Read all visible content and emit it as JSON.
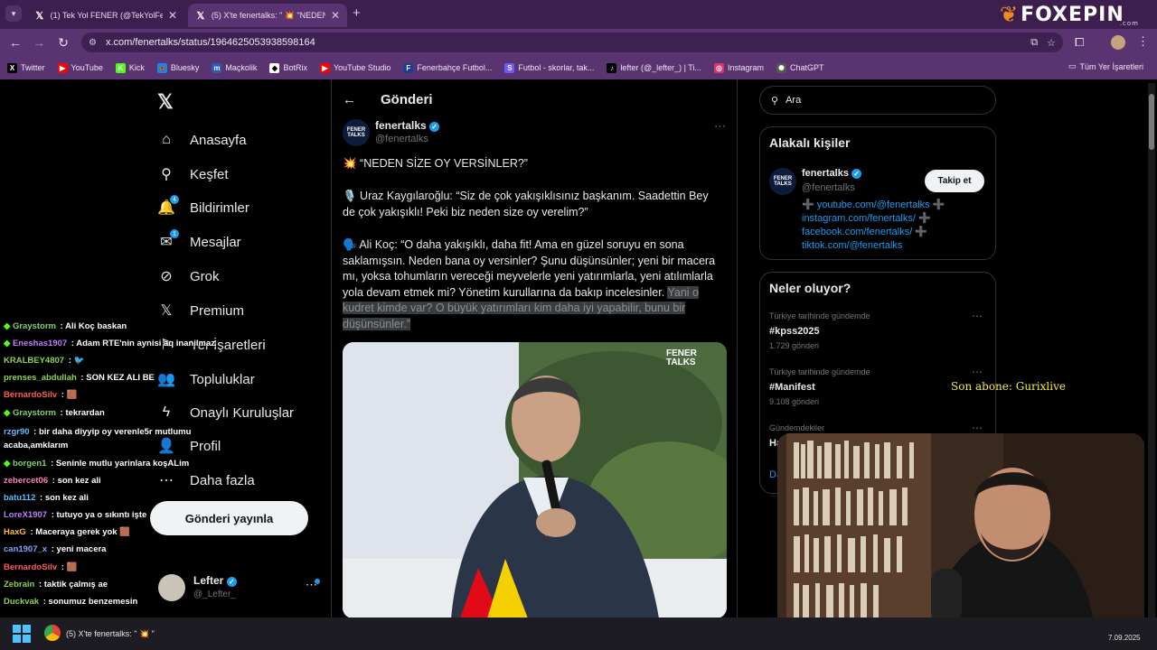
{
  "browser": {
    "tabs": [
      {
        "title": "(1) Tek Yol FENER (@TekYolFene",
        "favicon": "X"
      },
      {
        "title": "(5) X'te fenertalks: \" 💥 \"NEDEN",
        "favicon": "X"
      }
    ],
    "url": "x.com/fenertalks/status/1964625053938598164",
    "logo": "FOXEPIN",
    "logo_suffix": ".com",
    "bookmarks": [
      {
        "label": "Twitter",
        "icon": "X",
        "color": "#000000"
      },
      {
        "label": "YouTube",
        "icon": "▶",
        "color": "#ff0000"
      },
      {
        "label": "Kick",
        "icon": "K",
        "color": "#53fc18"
      },
      {
        "label": "Bluesky",
        "icon": "🦋",
        "color": "#1185fe"
      },
      {
        "label": "Maçkolik",
        "icon": "m",
        "color": "#2b5ab8"
      },
      {
        "label": "BotRix",
        "icon": "◆",
        "color": "#ffffff"
      },
      {
        "label": "YouTube Studio",
        "icon": "▶",
        "color": "#ff0000"
      },
      {
        "label": "Fenerbahçe Futbol...",
        "icon": "F",
        "color": "#1c3f94"
      },
      {
        "label": "Futbol - skorlar, tak...",
        "icon": "S",
        "color": "#6a5cff"
      },
      {
        "label": "lefter (@_lefter_) | Ti...",
        "icon": "♪",
        "color": "#000000"
      },
      {
        "label": "Instagram",
        "icon": "◎",
        "color": "#e1306c"
      },
      {
        "label": "ChatGPT",
        "icon": "✺",
        "color": "#555555"
      }
    ],
    "all_bookmarks": "Tüm Yer İşaretleri"
  },
  "sidebar": {
    "items": [
      {
        "label": "Anasayfa",
        "icon": "home-icon",
        "glyph": "⌂"
      },
      {
        "label": "Keşfet",
        "icon": "search-icon",
        "glyph": "⚲"
      },
      {
        "label": "Bildirimler",
        "icon": "bell-icon",
        "glyph": "🔔",
        "badge": "4"
      },
      {
        "label": "Mesajlar",
        "icon": "mail-icon",
        "glyph": "✉",
        "badge": "1"
      },
      {
        "label": "Grok",
        "icon": "grok-icon",
        "glyph": "⊘"
      },
      {
        "label": "Premium",
        "icon": "x-premium-icon",
        "glyph": "𝕏"
      },
      {
        "label": "Yer İşaretleri",
        "icon": "bookmark-icon",
        "glyph": "⚑"
      },
      {
        "label": "Topluluklar",
        "icon": "communities-icon",
        "glyph": "👥"
      },
      {
        "label": "Onaylı Kuruluşlar",
        "icon": "lightning-icon",
        "glyph": "ϟ"
      },
      {
        "label": "Profil",
        "icon": "profile-icon",
        "glyph": "👤"
      },
      {
        "label": "Daha fazla",
        "icon": "more-circle-icon",
        "glyph": "⋯"
      }
    ],
    "post_button": "Gönderi yayınla",
    "account": {
      "name": "Lefter",
      "handle": "@_Lefter_"
    }
  },
  "main": {
    "header": "Gönderi",
    "author": {
      "name": "fenertalks",
      "handle": "@fenertalks"
    },
    "paragraphs": [
      "💥 “NEDEN SİZE OY VERSİNLER?”",
      "🎙️ Uraz Kaygılaroğlu: “Siz de çok yakışıklısınız başkanım. Saadettin Bey de çok yakışıklı! Peki biz neden size oy verelim?”",
      "🗣️ Ali Koç: “O daha yakışıklı, daha fit! Ama en güzel soruyu en sona saklamışsın. Neden bana oy versinler? Şunu düşünsünler; yeni bir macera mı, yoksa tohumların vereceği meyvelerle yeni yatırımlarla, yeni atılımlarla yola devam etmek mi? Yönetim kurullarına da bakıp incelesinler."
    ],
    "highlighted": "Yani o kudret kimde var? O büyük yatırımları kim daha iyi yapabilir, bunu bir düşünsünler.”",
    "media_watermark": "FENER TALKS"
  },
  "right": {
    "search_placeholder": "Ara",
    "related": {
      "title": "Alakalı kişiler",
      "name": "fenertalks",
      "handle": "@fenertalks",
      "follow": "Takip et",
      "links": [
        "➕ youtube.com/@fenertalks ➕",
        "instagram.com/fenertalks/ ➕",
        "facebook.com/fenertalks/ ➕",
        "tiktok.com/@fenertalks"
      ]
    },
    "trends": {
      "title": "Neler oluyor?",
      "items": [
        {
          "meta": "Türkiye tarihinde gündemde",
          "name": "#kpss2025",
          "count": "1.729 gönderi"
        },
        {
          "meta": "Türkiye tarihinde gündemde",
          "name": "#Manifest",
          "count": "9.108 gönderi"
        },
        {
          "meta": "Gündemdekiler",
          "name": "Ha",
          "count": ""
        }
      ],
      "show_more": "Da"
    }
  },
  "overlay": {
    "subscriber": "Son abone: Gurixlive"
  },
  "chat": [
    {
      "user": "Graystorm",
      "msg": "Ali Koç baskan",
      "color": "#7fd36a",
      "diamond": true
    },
    {
      "user": "Eneshas1907",
      "msg": "Adam RTE'nin aynisi aq inanilmaz",
      "color": "#c07dff",
      "diamond": true
    },
    {
      "user": "KRALBEY4807",
      "msg": "🐦",
      "color": "#8fd14f",
      "diamond": false
    },
    {
      "user": "prenses_abdullah",
      "msg": "SON KEZ ALI BE",
      "color": "#8fd14f",
      "diamond": false
    },
    {
      "user": "BernardoSilv",
      "msg": "🟫",
      "color": "#ff5a5a",
      "diamond": false
    },
    {
      "user": "Graystorm",
      "msg": "tekrardan",
      "color": "#7fd36a",
      "diamond": true
    },
    {
      "user": "rzgr90",
      "msg": "bir daha diyyip oy verenle5r mutlumu acaba,amklarım",
      "color": "#5bc0ff",
      "diamond": false
    },
    {
      "user": "borgen1",
      "msg": "Seninle mutlu yarinlara koşALim",
      "color": "#7fd36a",
      "diamond": true
    },
    {
      "user": "zebercet06",
      "msg": "son kez ali",
      "color": "#ff7fbf",
      "diamond": false
    },
    {
      "user": "batu112",
      "msg": "son kez ali",
      "color": "#5bc0ff",
      "diamond": false
    },
    {
      "user": "LoreX1907",
      "msg": "tutuyo ya o sıkıntı işte",
      "color": "#c07dff",
      "diamond": false
    },
    {
      "user": "HaxG",
      "msg": "Maceraya gerek yok 🟫",
      "color": "#ffb84d",
      "diamond": false
    },
    {
      "user": "can1907_x",
      "msg": "yeni macera",
      "color": "#7fa8ff",
      "diamond": false
    },
    {
      "user": "BernardoSilv",
      "msg": "🟫",
      "color": "#ff5a5a",
      "diamond": false
    },
    {
      "user": "Zebrain",
      "msg": "taktik çalmış ae",
      "color": "#8fd14f",
      "diamond": false
    },
    {
      "user": "Duckvak",
      "msg": "sonumuz benzemesin",
      "color": "#8fd14f",
      "diamond": false
    }
  ],
  "taskbar": {
    "app_title": "(5) X'te fenertalks: \" 💥 \"",
    "date": "7.09.2025"
  }
}
